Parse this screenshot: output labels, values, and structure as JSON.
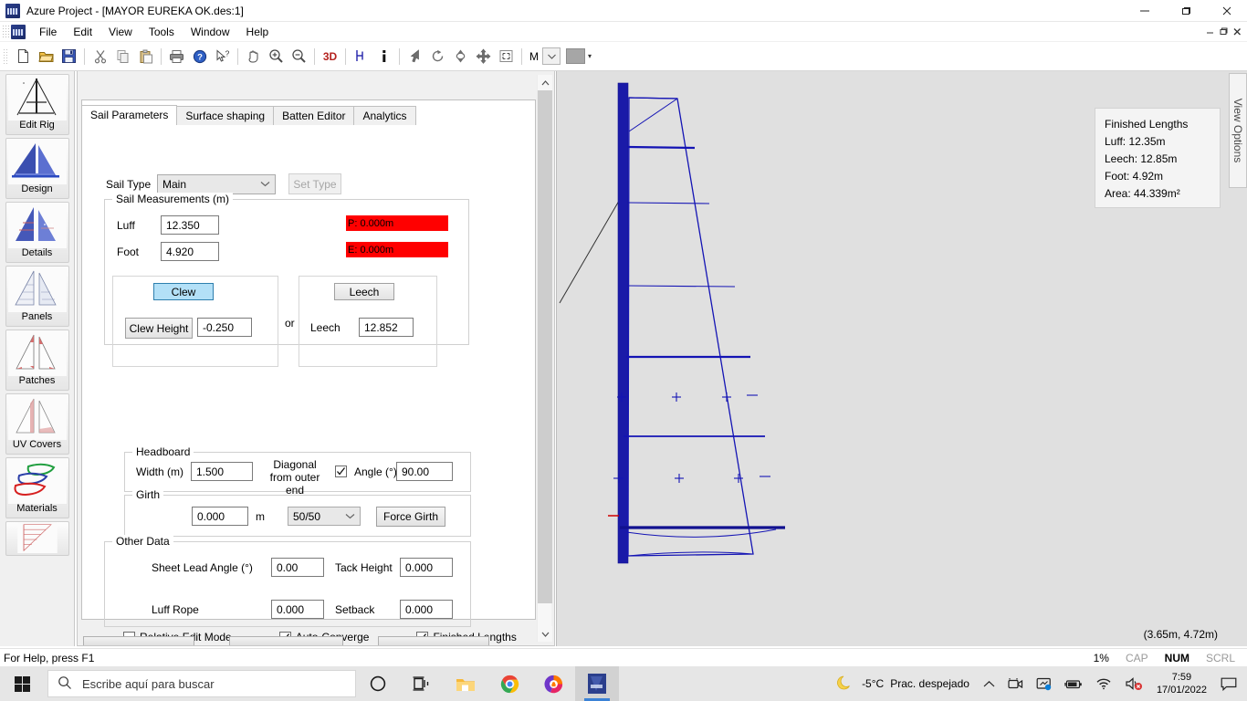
{
  "window": {
    "title": "Azure Project - [MAYOR EUREKA OK.des:1]",
    "app_icon": "azure-project-icon",
    "minimize": "—",
    "maximize": "❐",
    "close": "✕",
    "mdi_minimize": "–",
    "mdi_restore": "❐",
    "mdi_close": "✕"
  },
  "menu": {
    "items": [
      "File",
      "Edit",
      "View",
      "Tools",
      "Window",
      "Help"
    ]
  },
  "toolbar": {
    "items": [
      {
        "name": "new-icon",
        "glyph": "὜B"
      },
      {
        "name": "open-icon",
        "glyph": "open"
      },
      {
        "name": "save-icon",
        "glyph": "save"
      },
      {
        "name": "cut-icon",
        "glyph": "cut"
      },
      {
        "name": "copy-icon",
        "glyph": "copy"
      },
      {
        "name": "paste-icon",
        "glyph": "paste"
      },
      {
        "name": "print-icon",
        "glyph": "print"
      },
      {
        "name": "help-icon",
        "glyph": "help"
      },
      {
        "name": "context-help-icon",
        "glyph": "context-help"
      },
      {
        "name": "pan-icon",
        "glyph": "pan"
      },
      {
        "name": "zoom-in-icon",
        "glyph": "zoom-in"
      },
      {
        "name": "zoom-out-icon",
        "glyph": "zoom-out"
      },
      {
        "name": "three-d-icon",
        "glyph": "3D"
      },
      {
        "name": "measure-icon",
        "glyph": "measure"
      },
      {
        "name": "info-icon",
        "glyph": "i"
      },
      {
        "name": "select-arrow-icon",
        "glyph": "arrow"
      },
      {
        "name": "rotate-icon",
        "glyph": "rotate"
      },
      {
        "name": "flip-vertical-icon",
        "glyph": "flip"
      },
      {
        "name": "move-icon",
        "glyph": "move"
      },
      {
        "name": "fit-view-icon",
        "glyph": "fit"
      }
    ],
    "unit_label": "M",
    "unit_dropdown": "∨",
    "colour_swatch": "#a6a6a6",
    "overflow_caret": "▾"
  },
  "rail": {
    "items": [
      {
        "label": "Edit Rig",
        "icon": "edit-rig-icon"
      },
      {
        "label": "Design",
        "icon": "design-icon"
      },
      {
        "label": "Details",
        "icon": "details-icon"
      },
      {
        "label": "Panels",
        "icon": "panels-icon"
      },
      {
        "label": "Patches",
        "icon": "patches-icon"
      },
      {
        "label": "UV Covers",
        "icon": "uv-covers-icon"
      },
      {
        "label": "Materials",
        "icon": "materials-icon"
      },
      {
        "label": "",
        "icon": "graph-icon"
      }
    ]
  },
  "tabs": [
    {
      "label": "Sail Parameters",
      "active": true
    },
    {
      "label": "Surface shaping",
      "active": false
    },
    {
      "label": "Batten Editor",
      "active": false
    },
    {
      "label": "Analytics",
      "active": false
    }
  ],
  "sail_params": {
    "sail_type_label": "Sail Type",
    "sail_type_value": "Main",
    "sail_type_arrow": "∨",
    "set_type_button": "Set Type",
    "measurements": {
      "legend": "Sail Measurements (m)",
      "luff_label": "Luff",
      "luff_value": "12.350",
      "foot_label": "Foot",
      "foot_value": "4.920",
      "warn_p": "P: 0.000m",
      "warn_e": "E: 0.000m",
      "warn_color": "#ff0000"
    },
    "clew_group": {
      "clew_button": "Clew",
      "clew_height_button": "Clew Height",
      "clew_height_value": "-0.250",
      "selected_accent": "#b3e0f7"
    },
    "or_text": "or",
    "leech_group": {
      "leech_button": "Leech",
      "leech_label": "Leech",
      "leech_value": "12.852"
    },
    "headboard": {
      "legend": "Headboard",
      "width_label": "Width (m)",
      "width_value": "1.500",
      "diagonal_label": "Diagonal from outer end",
      "diagonal_checked": true,
      "angle_label": "Angle (°)",
      "angle_value": "90.00"
    },
    "girth": {
      "legend": "Girth",
      "value": "0.000",
      "unit": "m",
      "ratio": "50/50",
      "ratio_arrow": "∨",
      "force_button": "Force Girth"
    },
    "other_data": {
      "legend": "Other Data",
      "sheet_lead_angle_label": "Sheet Lead Angle (°)",
      "sheet_lead_angle_value": "0.00",
      "tack_height_label": "Tack Height",
      "tack_height_value": "0.000",
      "luff_rope_label": "Luff Rope",
      "luff_rope_value": "0.000",
      "setback_label": "Setback",
      "setback_value": "0.000"
    },
    "checkboxes": [
      {
        "label": "Relative Edit Mode",
        "checked": false
      },
      {
        "label": "Auto-Converge",
        "checked": true
      },
      {
        "label": "Finished Lengths",
        "checked": true
      }
    ]
  },
  "canvas": {
    "view_options_tab": "View Options",
    "finished_lengths": {
      "title": "Finished Lengths",
      "luff": "Luff:  12.35m",
      "leech": "Leech:  12.85m",
      "foot": "Foot:  4.92m",
      "area": "Area:  44.339m²"
    },
    "coordinates": "(3.65m, 4.72m)",
    "sail_color": "#1414b4",
    "mast_color": "#1a1aa8",
    "background": "#e0e0e0"
  },
  "statusbar": {
    "help_text": "For Help, press F1",
    "zoom": "1%",
    "cap": "CAP",
    "num": "NUM",
    "scrl": "SCRL"
  },
  "taskbar": {
    "search_placeholder": "Escribe aquí para buscar",
    "apps": [
      {
        "name": "cortana-icon"
      },
      {
        "name": "task-view-icon"
      },
      {
        "name": "file-explorer-icon"
      },
      {
        "name": "chrome-icon"
      },
      {
        "name": "avast-browser-icon"
      },
      {
        "name": "azure-project-icon"
      }
    ],
    "weather_temp": "-5°C",
    "weather_text": "Prac. despejado",
    "time": "7:59",
    "date": "17/01/2022",
    "tray_icons": [
      "chevron-up-icon",
      "webcam-icon",
      "display-icon",
      "battery-icon",
      "wifi-icon",
      "volume-muted-icon"
    ],
    "action_center": "notification-icon"
  }
}
